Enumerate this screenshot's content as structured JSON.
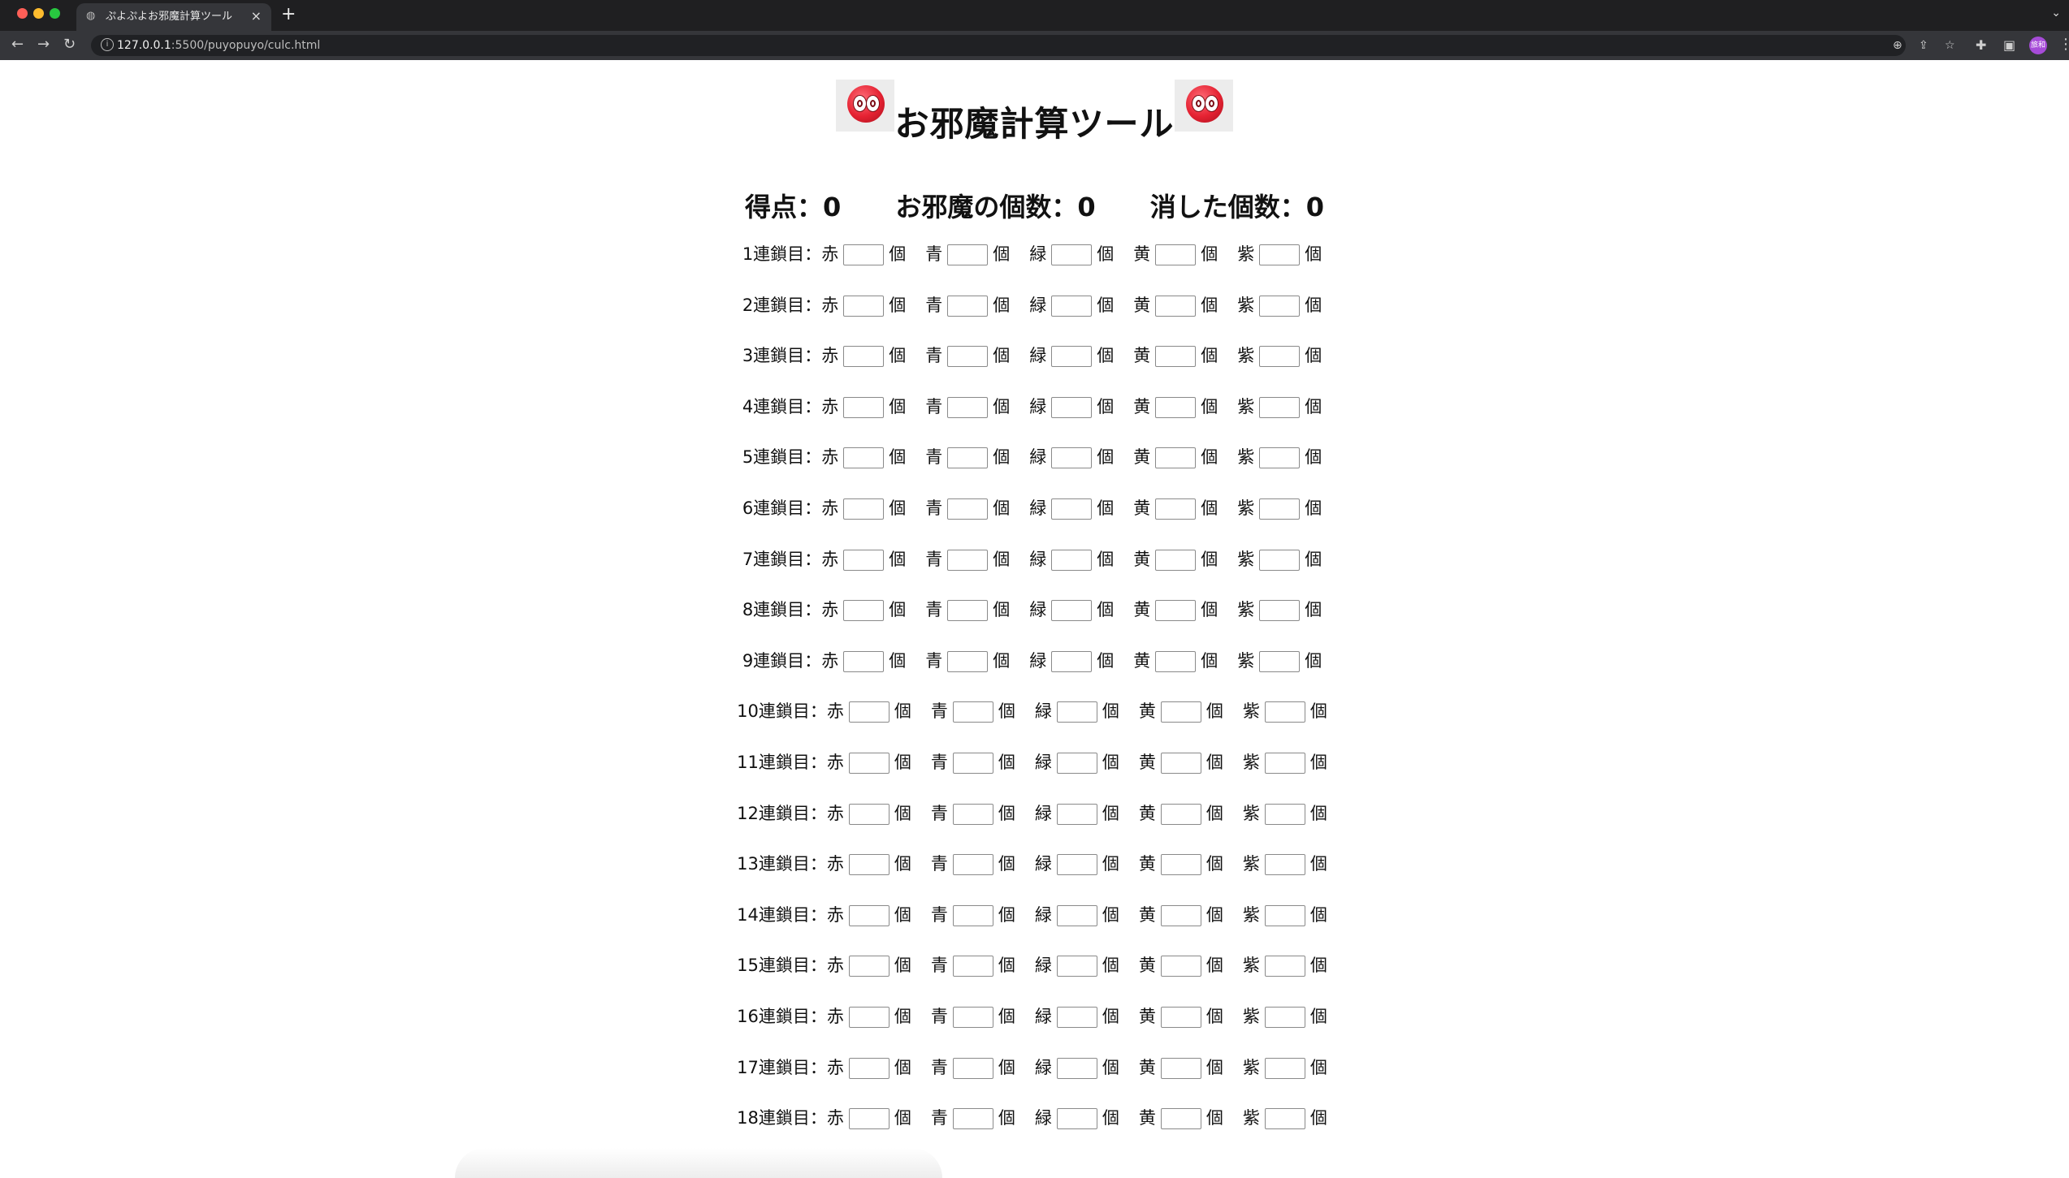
{
  "browser": {
    "tab_title": "ぷよぷよお邪魔計算ツール",
    "url_host": "127.0.0.1",
    "url_path": ":5500/puyopuyo/culc.html",
    "avatar_text": "旅和"
  },
  "page": {
    "title": "お邪魔計算ツール",
    "stats": [
      {
        "label": "得点：",
        "value": "0"
      },
      {
        "label": "お邪魔の個数：",
        "value": "0"
      },
      {
        "label": "消した個数：",
        "value": "0"
      }
    ],
    "colors": [
      "赤",
      "青",
      "緑",
      "黄",
      "紫"
    ],
    "unit": "個",
    "chains": [
      "1連鎖目：",
      "2連鎖目：",
      "3連鎖目：",
      "4連鎖目：",
      "5連鎖目：",
      "6連鎖目：",
      "7連鎖目：",
      "8連鎖目：",
      "9連鎖目：",
      "10連鎖目：",
      "11連鎖目：",
      "12連鎖目：",
      "13連鎖目：",
      "14連鎖目：",
      "15連鎖目：",
      "16連鎖目：",
      "17連鎖目：",
      "18連鎖目："
    ]
  },
  "icons": {
    "puyo_image": "red-puyo-icon",
    "favicon": "globe-icon"
  }
}
